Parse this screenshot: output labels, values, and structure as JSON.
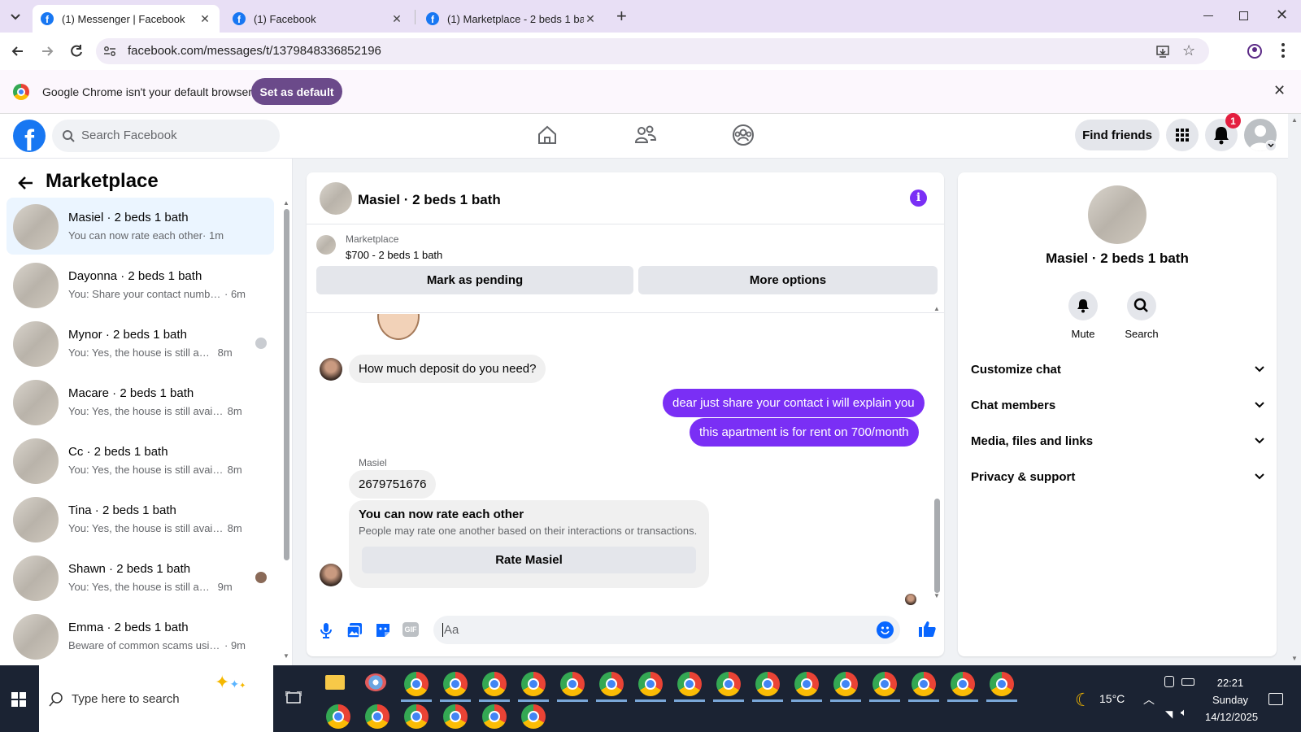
{
  "browser": {
    "tabs": [
      {
        "title": "(1) Messenger | Facebook",
        "active": true
      },
      {
        "title": "(1) Facebook",
        "active": false
      },
      {
        "title": "(1) Marketplace - 2 beds 1 bath",
        "active": false
      }
    ],
    "url": "facebook.com/messages/t/1379848336852196",
    "infobar_text": "Google Chrome isn't your default browser",
    "infobar_button": "Set as default"
  },
  "fb_nav": {
    "search_placeholder": "Search Facebook",
    "find_friends": "Find friends",
    "notification_count": "1"
  },
  "sidebar": {
    "title": "Marketplace",
    "conversations": [
      {
        "name": "Masiel · 2 beds 1 bath",
        "preview": "You can now rate each other",
        "time": "· 1m",
        "selected": true
      },
      {
        "name": "Dayonna · 2 beds 1 bath",
        "preview": "You: Share your contact number fo...",
        "time": "· 6m"
      },
      {
        "name": "Mynor · 2 beds 1 bath",
        "preview": "You: Yes, the house is still availa...",
        "time": "8m"
      },
      {
        "name": "Macare · 2 beds 1 bath",
        "preview": "You: Yes, the house is still available...",
        "time": "8m"
      },
      {
        "name": "Cc · 2 beds 1 bath",
        "preview": "You: Yes, the house is still available...",
        "time": "8m"
      },
      {
        "name": "Tina · 2 beds 1 bath",
        "preview": "You: Yes, the house is still available...",
        "time": "8m"
      },
      {
        "name": "Shawn · 2 beds 1 bath",
        "preview": "You: Yes, the house is still availa...",
        "time": "9m"
      },
      {
        "name": "Emma · 2 beds 1 bath",
        "preview": "Beware of common scams using p...",
        "time": "· 9m"
      }
    ]
  },
  "chat": {
    "header_title": "Masiel · 2 beds 1 bath",
    "listing_label": "Marketplace",
    "listing_title": "$700 - 2 beds 1 bath",
    "mark_pending": "Mark as pending",
    "more_options": "More options",
    "msg1": "How much deposit do you need?",
    "msg2": "dear just share your contact i will explain you",
    "msg3": "this apartment is for rent on 700/month",
    "sender_name": "Masiel",
    "msg4": "2679751676",
    "rate_title": "You can now rate each other",
    "rate_body": "People may rate one another based on their interactions or transactions.",
    "rate_button": "Rate Masiel",
    "composer_placeholder": "Aa",
    "accent": "#7a2ff5"
  },
  "details": {
    "name": "Masiel · 2 beds 1 bath",
    "mute": "Mute",
    "search": "Search",
    "sections": [
      "Customize chat",
      "Chat members",
      "Media, files and links",
      "Privacy & support"
    ]
  },
  "taskbar": {
    "search_placeholder": "Type here to search",
    "weather": "15°C",
    "time": "22:21",
    "day": "Sunday",
    "date": "14/12/2025"
  }
}
